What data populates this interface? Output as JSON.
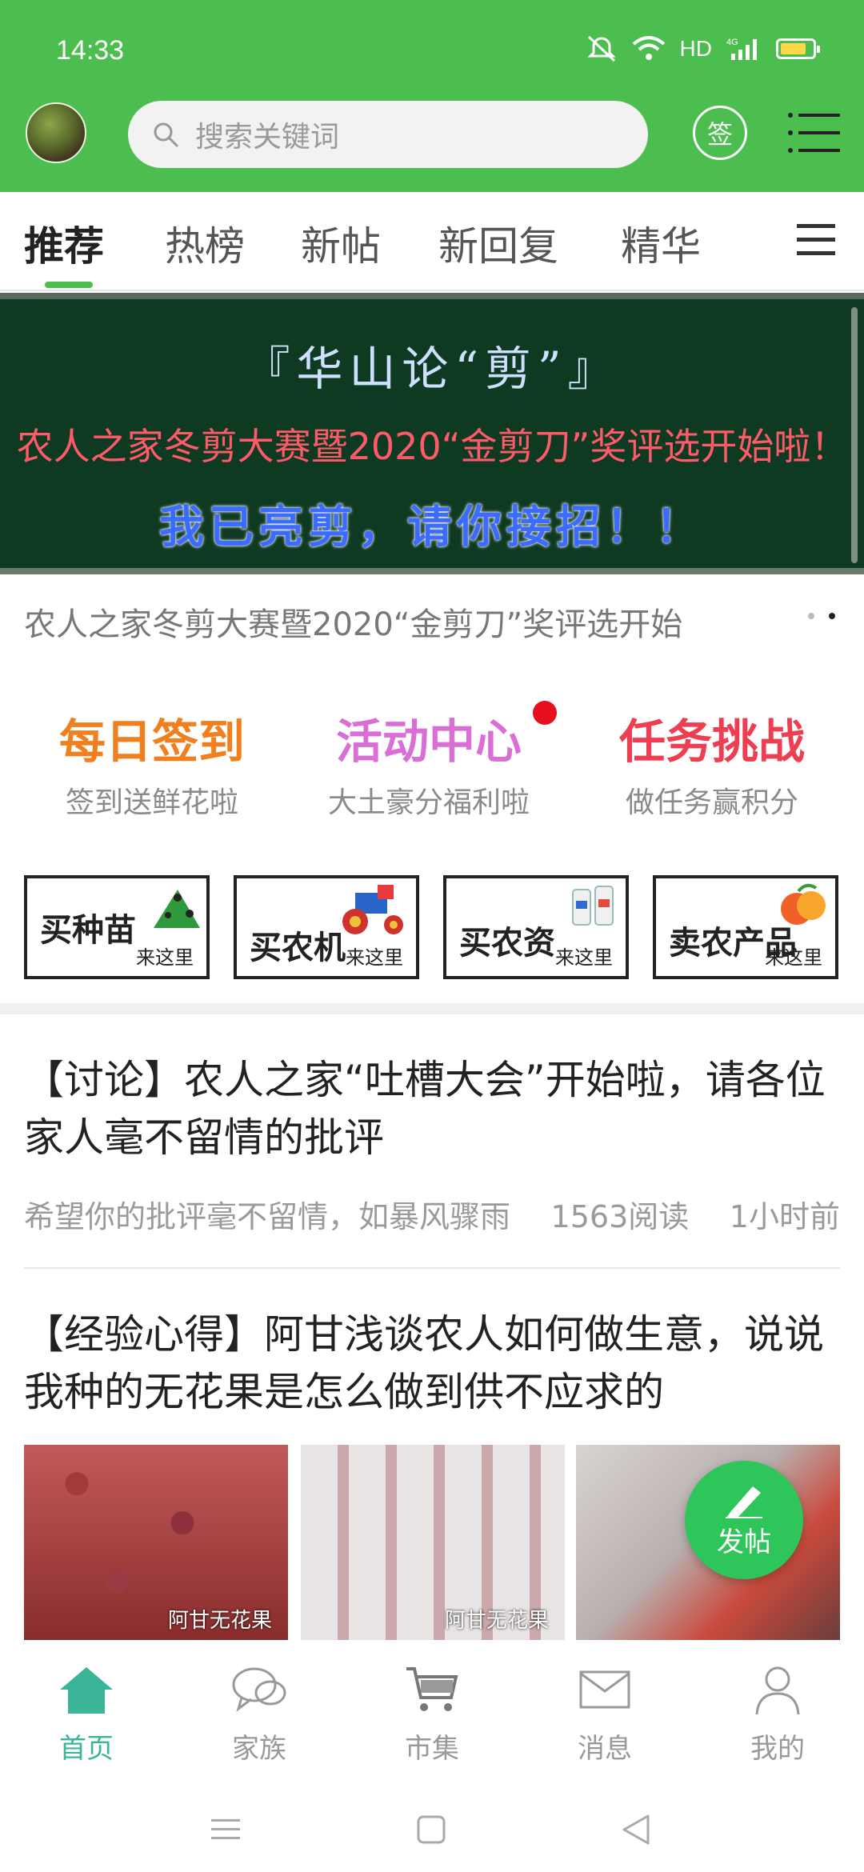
{
  "status_bar": {
    "time": "14:33",
    "hd": "HD",
    "network": "4G",
    "battery_color": "#ffd84a"
  },
  "header": {
    "search_placeholder": "搜索关键词",
    "sign_label": "签",
    "accent": "#4cbe4f"
  },
  "tabs": {
    "items": [
      "推荐",
      "热榜",
      "新帖",
      "新回复",
      "精华"
    ],
    "active": "推荐"
  },
  "banner": {
    "line1": "『华山论“剪”』",
    "line2": "农人之家冬剪大赛暨2020“金剪刀”奖评选开始啦！",
    "line3": "我已亮剪，请你接招！！",
    "caption": "农人之家冬剪大赛暨2020“金剪刀”奖评选开始"
  },
  "activities": [
    {
      "title": "每日签到",
      "subtitle": "签到送鲜花啦",
      "color": "#f07f1e"
    },
    {
      "title": "活动中心",
      "subtitle": "大土豪分福利啦",
      "color": "#d96fd6"
    },
    {
      "title": "任务挑战",
      "subtitle": "做任务赢积分",
      "color": "#ee3e52"
    }
  ],
  "shortcuts": [
    {
      "label": "买种苗",
      "sub": "来这里"
    },
    {
      "label": "买农机",
      "sub": "来这里"
    },
    {
      "label": "买农资",
      "sub": "来这里"
    },
    {
      "label": "卖农产品",
      "sub": "来这里"
    }
  ],
  "posts": [
    {
      "title": "【讨论】农人之家“吐槽大会”开始啦，请各位家人毫不留情的批评",
      "excerpt": "希望你的批评毫不留情，如暴风骤雨",
      "reads": "1563阅读",
      "time": "1小时前"
    },
    {
      "title": "【经验心得】阿甘浅谈农人如何做生意，说说我种的无花果是怎么做到供不应求的",
      "thumb_labels": [
        "阿甘无花果",
        "阿甘无花果",
        ""
      ]
    }
  ],
  "fab": {
    "label": "发帖"
  },
  "bottom_nav": {
    "items": [
      "首页",
      "家族",
      "市集",
      "消息",
      "我的"
    ],
    "active": "首页",
    "active_color": "#3bb598"
  }
}
